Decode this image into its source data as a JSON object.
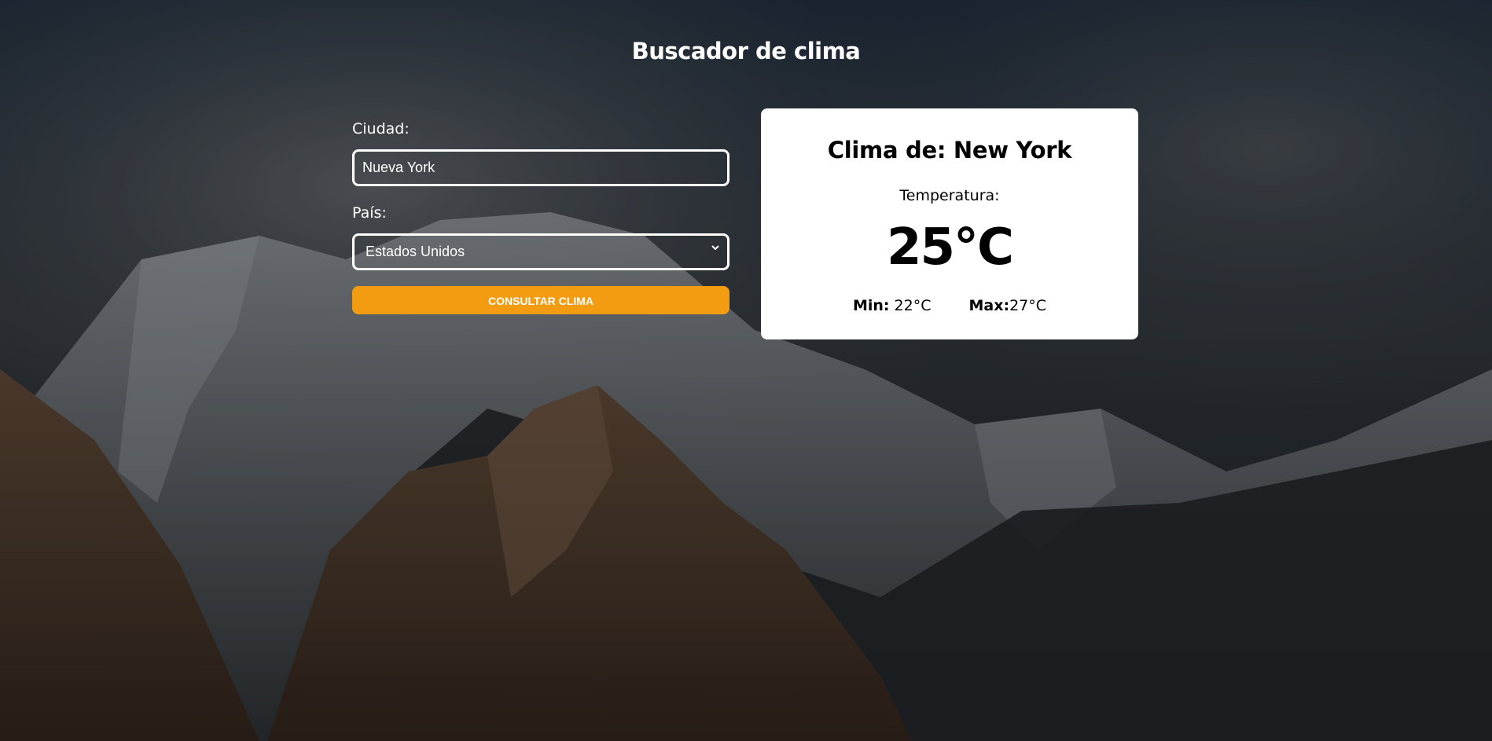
{
  "page": {
    "title": "Buscador de clima"
  },
  "form": {
    "city_label": "Ciudad:",
    "city_value": "Nueva York",
    "country_label": "País:",
    "country_selected": "Estados Unidos",
    "submit_label": "Consultar clima"
  },
  "result": {
    "heading": "Clima de: New York",
    "temperature_label": "Temperatura:",
    "temperature": "25°C",
    "min_label": "Min:",
    "min_value": "22°C",
    "max_label": "Max:",
    "max_value": "27°C"
  },
  "colors": {
    "accent": "#f39c12",
    "card_background": "#ffffff",
    "text_light": "#ffffff"
  },
  "icons": {
    "select_arrow": "chevron-down-icon"
  }
}
